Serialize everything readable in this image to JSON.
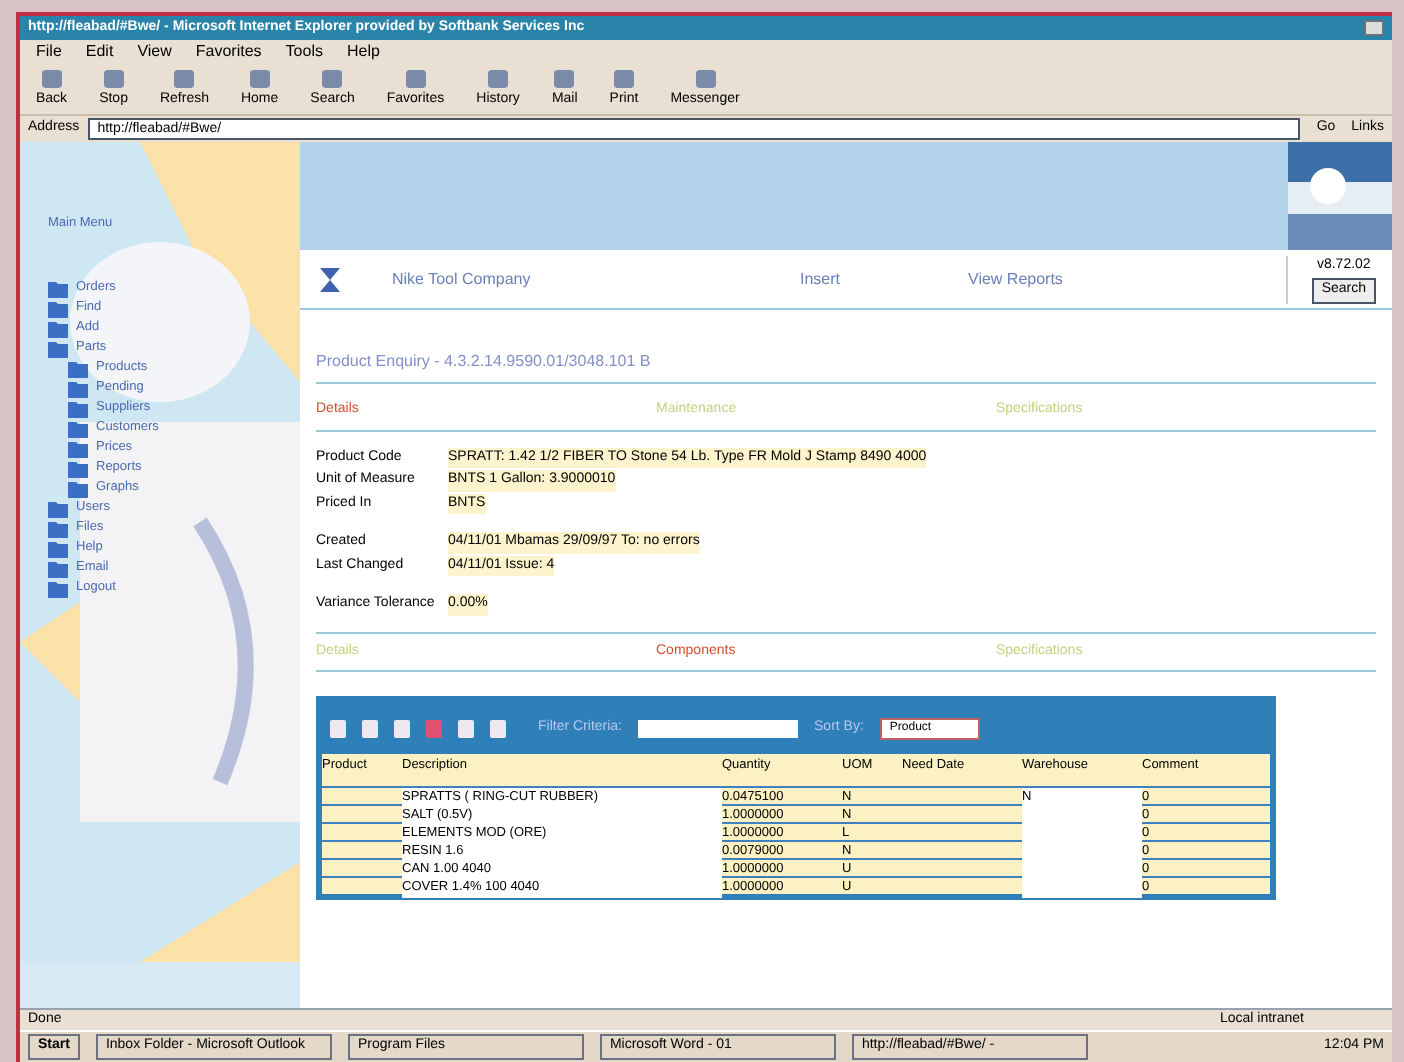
{
  "window": {
    "title": "http://fleabad/#Bwe/ - Microsoft Internet Explorer provided by Softbank Services Inc"
  },
  "menu": [
    "File",
    "Edit",
    "View",
    "Favorites",
    "Tools",
    "Help"
  ],
  "toolbar": [
    {
      "label": "Back"
    },
    {
      "label": "Stop"
    },
    {
      "label": "Refresh"
    },
    {
      "label": "Home"
    },
    {
      "label": "Search"
    },
    {
      "label": "Favorites"
    },
    {
      "label": "History"
    },
    {
      "label": "Mail"
    },
    {
      "label": "Print"
    },
    {
      "label": "Messenger"
    }
  ],
  "address": {
    "label": "Address",
    "value": "http://fleabad/#Bwe/",
    "go": "Go",
    "links": "Links"
  },
  "sidebar": {
    "title": "Main Menu",
    "items": [
      {
        "label": "Orders"
      },
      {
        "label": "Find"
      },
      {
        "label": "Add"
      },
      {
        "label": "Parts",
        "children": [
          {
            "label": "Products"
          },
          {
            "label": "Pending"
          },
          {
            "label": "Suppliers"
          },
          {
            "label": "Customers"
          },
          {
            "label": "Prices"
          },
          {
            "label": "Reports"
          },
          {
            "label": "Graphs"
          }
        ]
      },
      {
        "label": "Users"
      },
      {
        "label": "Files"
      },
      {
        "label": "Help"
      },
      {
        "label": "Email"
      },
      {
        "label": "Logout"
      }
    ]
  },
  "header": {
    "company": "Nike Tool Company",
    "links": [
      "Insert",
      "View Reports"
    ],
    "date": "v8.72.02",
    "button": "Search"
  },
  "page_title": "Product Enquiry - 4.3.2.14.9590.01/3048.101 B",
  "tabs_top": [
    {
      "label": "Details",
      "selected": true
    },
    {
      "label": "Maintenance",
      "selected": false
    },
    {
      "label": "Specifications",
      "selected": false
    }
  ],
  "fields": [
    {
      "label": "Product Code",
      "value": "SPRATT: 1.42 1/2 FIBER TO Stone 54 Lb. Type FR Mold J Stamp 8490 4000"
    },
    {
      "label": "Unit of Measure",
      "value": "BNTS 1 Gallon: 3.9000010"
    },
    {
      "label": "Priced In",
      "value": "BNTS"
    },
    {
      "label": "Created",
      "value": "04/11/01 Mbamas 29/09/97 To: no errors"
    },
    {
      "label": "Last Changed",
      "value": "04/11/01 Issue: 4"
    },
    {
      "label": "Variance Tolerance",
      "value": "0.00%"
    }
  ],
  "tabs_bottom": [
    {
      "label": "Details",
      "selected": false
    },
    {
      "label": "Components",
      "selected": true
    },
    {
      "label": "Specifications",
      "selected": false
    }
  ],
  "grid": {
    "search_label": "Filter Criteria:",
    "sort_label": "Sort By:",
    "sort_value": "Product",
    "columns": [
      "Product",
      "Description",
      "Quantity",
      "UOM",
      "Need Date",
      "Warehouse",
      "Comment"
    ],
    "rows": [
      [
        "",
        "SPRATTS ( RING-CUT RUBBER)",
        "0.0475100",
        "N",
        "",
        "N",
        "0"
      ],
      [
        "",
        "SALT (0.5V)",
        "1.0000000",
        "N",
        "",
        "",
        "0"
      ],
      [
        "",
        "ELEMENTS MOD (ORE)",
        "1.0000000",
        "L",
        "",
        "",
        "0"
      ],
      [
        "",
        "RESIN 1.6",
        "0.0079000",
        "N",
        "",
        "",
        "0"
      ],
      [
        "",
        "CAN 1.00 4040",
        "1.0000000",
        "U",
        "",
        "",
        "0"
      ],
      [
        "",
        "COVER 1.4% 100 4040",
        "1.0000000",
        "U",
        "",
        "",
        "0"
      ]
    ]
  },
  "status": {
    "left": "Done",
    "zone": "Local intranet"
  },
  "taskbar": {
    "start": "Start",
    "tasks": [
      "Inbox Folder - Microsoft Outlook",
      "Program Files",
      "Microsoft Word - 01",
      "http://fleabad/#Bwe/ -"
    ],
    "clock": "12:04 PM"
  }
}
